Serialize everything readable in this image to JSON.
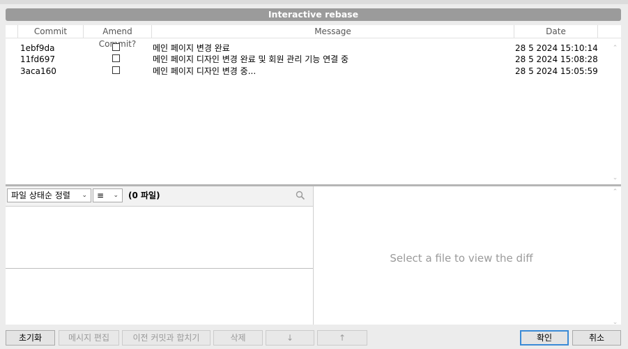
{
  "window": {
    "title": "Interactive rebase"
  },
  "commit_table": {
    "columns": {
      "commit": "Commit",
      "amend": "Amend Commit?",
      "message": "Message",
      "date": "Date"
    },
    "rows": [
      {
        "commit": "1ebf9da",
        "amend": false,
        "message": "메인 페이지 변경 완료",
        "date": "28 5 2024 15:10:14"
      },
      {
        "commit": "11fd697",
        "amend": false,
        "message": "메인 페이지 디자인 변경 완료 및 회원 관리 기능 연결 중",
        "date": "28 5 2024 15:08:28"
      },
      {
        "commit": "3aca160",
        "amend": false,
        "message": "메인 페이지 디자인 변경 중...",
        "date": "28 5 2024 15:05:59"
      }
    ]
  },
  "files": {
    "sort_dropdown": "파일 상태순 정렬",
    "view_dropdown_icon": "list-icon",
    "count_label": "(0 파일)",
    "search_icon": "search-icon"
  },
  "diff": {
    "placeholder": "Select a file to view the diff"
  },
  "buttons": {
    "reset": "초기화",
    "edit_message": "메시지 편집",
    "squash_previous": "이전 커밋과 합치기",
    "delete": "삭제",
    "move_down": "↓",
    "move_up": "↑",
    "ok": "확인",
    "cancel": "취소"
  },
  "colors": {
    "title_bar": "#9b9b9b",
    "primary_border": "#3a8ad6"
  }
}
